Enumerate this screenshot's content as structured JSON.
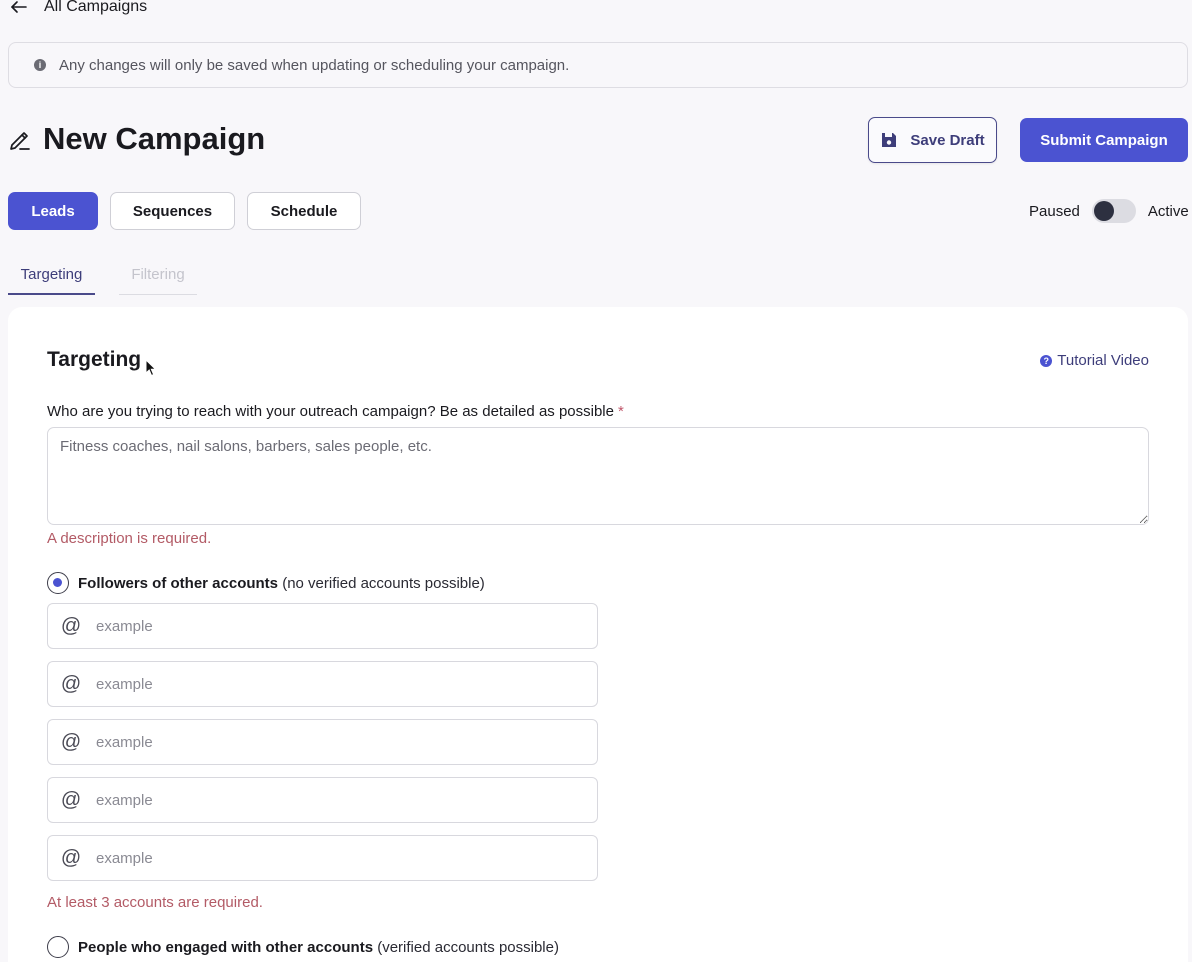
{
  "nav": {
    "back_label": "All Campaigns"
  },
  "banner": {
    "text": "Any changes will only be saved when updating or scheduling your campaign."
  },
  "header": {
    "title": "New Campaign",
    "save_draft_label": "Save Draft",
    "submit_label": "Submit Campaign"
  },
  "tabs": [
    {
      "label": "Leads",
      "active": true
    },
    {
      "label": "Sequences",
      "active": false
    },
    {
      "label": "Schedule",
      "active": false
    }
  ],
  "status_toggle": {
    "off_label": "Paused",
    "on_label": "Active",
    "is_active": false
  },
  "subtabs": [
    {
      "label": "Targeting",
      "active": true
    },
    {
      "label": "Filtering",
      "active": false
    }
  ],
  "targeting": {
    "title": "Targeting",
    "tutorial_label": "Tutorial Video",
    "question_label": "Who are you trying to reach with your outreach campaign? Be as detailed as possible",
    "required_mark": "*",
    "description_placeholder": "Fitness coaches, nail salons, barbers, sales people, etc.",
    "description_value": "",
    "description_error": "A description is required.",
    "option_followers": {
      "title": "Followers of other accounts",
      "hint": "(no verified accounts possible)",
      "selected": true
    },
    "accounts": [
      {
        "prefix": "@",
        "placeholder": "example",
        "value": ""
      },
      {
        "prefix": "@",
        "placeholder": "example",
        "value": ""
      },
      {
        "prefix": "@",
        "placeholder": "example",
        "value": ""
      },
      {
        "prefix": "@",
        "placeholder": "example",
        "value": ""
      },
      {
        "prefix": "@",
        "placeholder": "example",
        "value": ""
      }
    ],
    "accounts_error": "At least 3 accounts are required.",
    "option_engaged": {
      "title": "People who engaged with other accounts",
      "hint": "(verified accounts possible)",
      "selected": false
    }
  },
  "colors": {
    "accent": "#4b53d1",
    "error": "#b35b66",
    "page_bg": "#f8f7fa"
  }
}
